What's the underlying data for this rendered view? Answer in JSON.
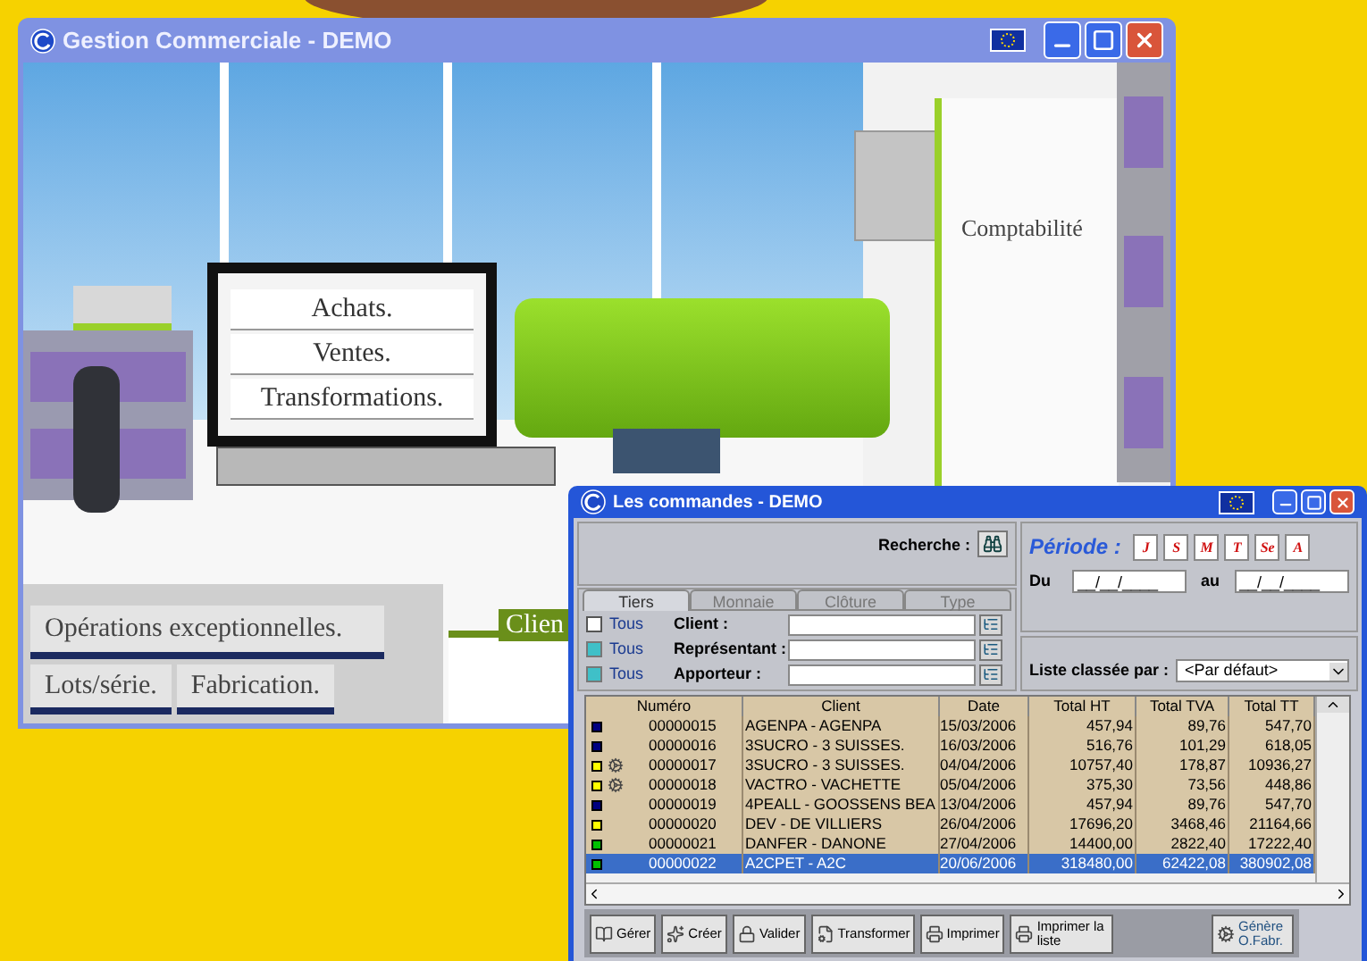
{
  "main_window": {
    "title": "Gestion Commerciale - DEMO",
    "scene": {
      "monitor_menu": [
        "Achats.",
        "Ventes.",
        "Transformations."
      ],
      "door_label": "Comptabilité",
      "bottom_menu": [
        "Opérations exceptionnelles.",
        "Lots/série.",
        "Fabrication."
      ],
      "folder_tab": "Clien"
    }
  },
  "orders_window": {
    "title": "Les commandes - DEMO",
    "search_label": "Recherche :",
    "period": {
      "label": "Période :",
      "buttons": [
        "J",
        "S",
        "M",
        "T",
        "Se",
        "A"
      ],
      "from_label": "Du",
      "from_value": "__/__/____",
      "to_label": "au",
      "to_value": "__/__/____"
    },
    "tabs": [
      {
        "label": "Tiers",
        "selected": true
      },
      {
        "label": "Monnaie",
        "selected": false
      },
      {
        "label": "Clôture",
        "selected": false
      },
      {
        "label": "Type",
        "selected": false
      }
    ],
    "filters": [
      {
        "all_label": "Tous",
        "checked": false,
        "label": "Client :"
      },
      {
        "all_label": "Tous",
        "checked": true,
        "label": "Représentant :"
      },
      {
        "all_label": "Tous",
        "checked": true,
        "label": "Apporteur :"
      }
    ],
    "sort": {
      "label": "Liste classée par :",
      "value": "<Par défaut>"
    },
    "table": {
      "columns": [
        "Numéro",
        "Client",
        "Date",
        "Total HT",
        "Total TVA",
        "Total TT"
      ],
      "rows": [
        {
          "color": "#000080",
          "gear": false,
          "selected": false,
          "cells": [
            "00000015",
            "AGENPA - AGENPA",
            "15/03/2006",
            "457,94",
            "89,76",
            "547,70"
          ]
        },
        {
          "color": "#000080",
          "gear": false,
          "selected": false,
          "cells": [
            "00000016",
            "3SUCRO - 3 SUISSES.",
            "16/03/2006",
            "516,76",
            "101,29",
            "618,05"
          ]
        },
        {
          "color": "#ffff00",
          "gear": true,
          "selected": false,
          "cells": [
            "00000017",
            "3SUCRO - 3 SUISSES.",
            "04/04/2006",
            "10757,40",
            "178,87",
            "10936,27"
          ]
        },
        {
          "color": "#ffff00",
          "gear": true,
          "selected": false,
          "cells": [
            "00000018",
            "VACTRO - VACHETTE",
            "05/04/2006",
            "375,30",
            "73,56",
            "448,86"
          ]
        },
        {
          "color": "#000080",
          "gear": false,
          "selected": false,
          "cells": [
            "00000019",
            "4PEALL - GOOSSENS BEA",
            "13/04/2006",
            "457,94",
            "89,76",
            "547,70"
          ]
        },
        {
          "color": "#ffff00",
          "gear": false,
          "selected": false,
          "cells": [
            "00000020",
            "DEV - DE VILLIERS",
            "26/04/2006",
            "17696,20",
            "3468,46",
            "21164,66"
          ]
        },
        {
          "color": "#00c000",
          "gear": false,
          "selected": false,
          "cells": [
            "00000021",
            "DANFER - DANONE",
            "27/04/2006",
            "14400,00",
            "2822,40",
            "17222,40"
          ]
        },
        {
          "color": "#00c000",
          "gear": false,
          "selected": true,
          "cells": [
            "00000022",
            "A2CPET - A2C",
            "20/06/2006",
            "318480,00",
            "62422,08",
            "380902,08"
          ]
        }
      ]
    },
    "buttons": [
      "Gérer",
      "Créer",
      "Valider",
      "Transformer",
      "Imprimer",
      "Imprimer la liste",
      "Génère O.Fabr."
    ]
  }
}
